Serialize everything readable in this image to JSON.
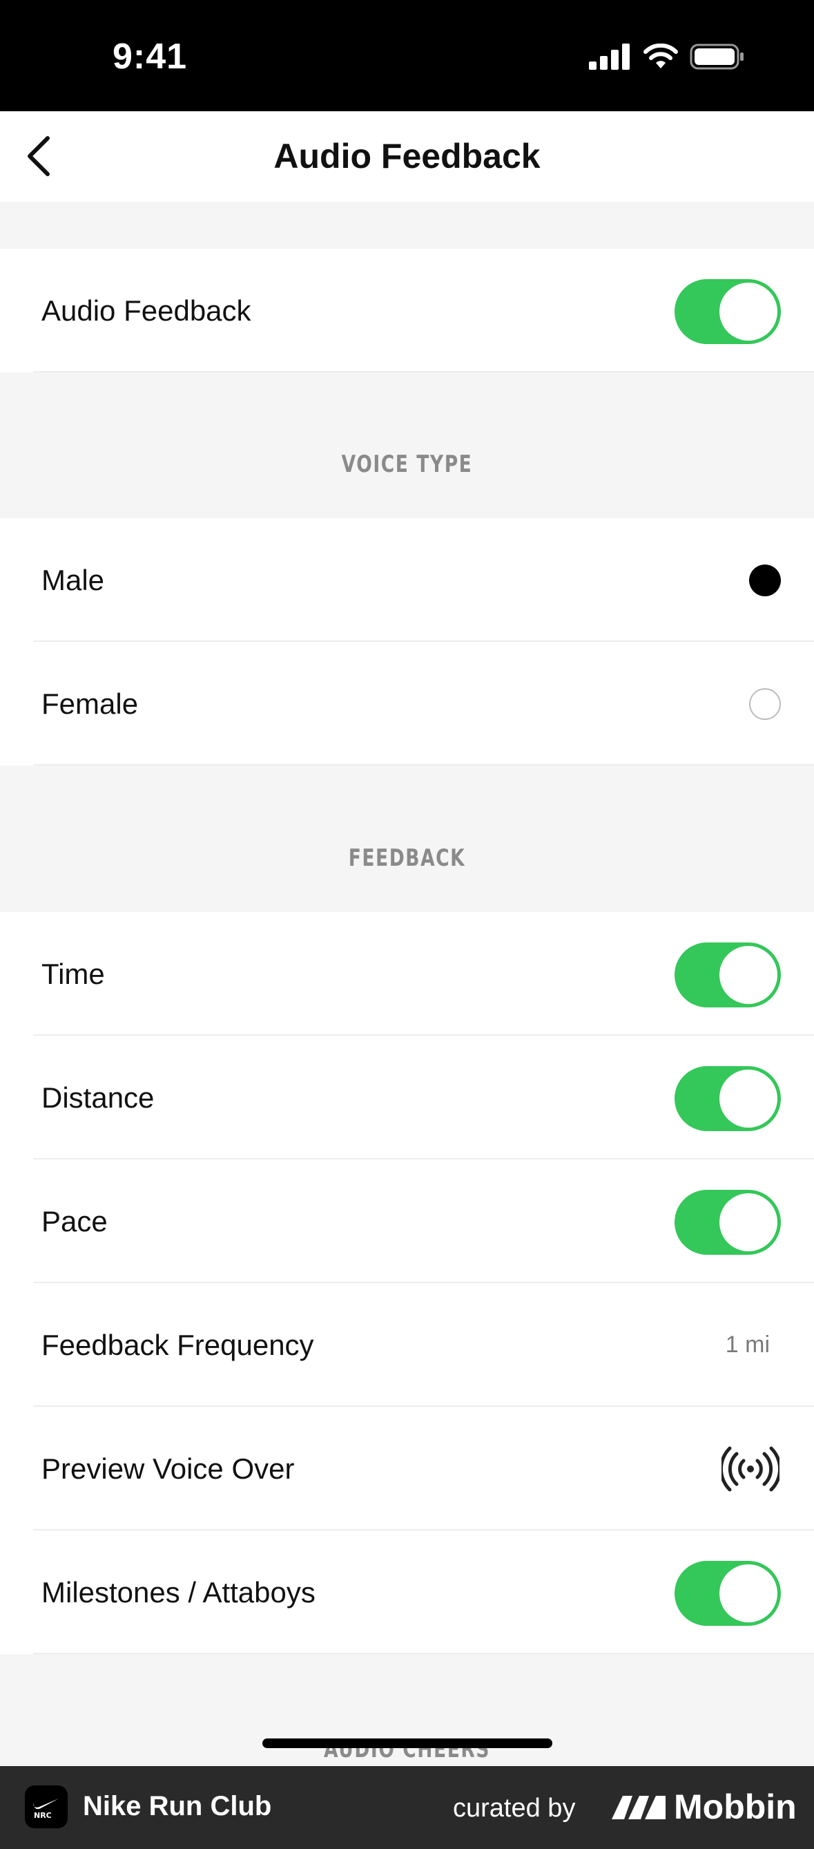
{
  "status_bar": {
    "time": "9:41"
  },
  "nav": {
    "title": "Audio Feedback"
  },
  "audio_feedback": {
    "label": "Audio Feedback",
    "enabled": true
  },
  "voice_type": {
    "header": "VOICE TYPE",
    "options": [
      {
        "label": "Male",
        "selected": true
      },
      {
        "label": "Female",
        "selected": false
      }
    ]
  },
  "feedback": {
    "header": "FEEDBACK",
    "time": {
      "label": "Time",
      "enabled": true
    },
    "distance": {
      "label": "Distance",
      "enabled": true
    },
    "pace": {
      "label": "Pace",
      "enabled": true
    },
    "frequency": {
      "label": "Feedback Frequency",
      "value": "1 mi"
    },
    "preview": {
      "label": "Preview Voice Over",
      "icon": "broadcast-icon"
    },
    "milestones": {
      "label": "Milestones / Attaboys",
      "enabled": true
    }
  },
  "audio_cheers": {
    "header": "AUDIO CHEERS"
  },
  "footer": {
    "app_name": "Nike Run Club",
    "logo_text": "NRC",
    "curated_by": "curated by",
    "brand": "Mobbin"
  },
  "colors": {
    "toggle_on": "#34c759",
    "page_bg": "#f5f5f5",
    "footer_bg": "#2a2a2a"
  }
}
